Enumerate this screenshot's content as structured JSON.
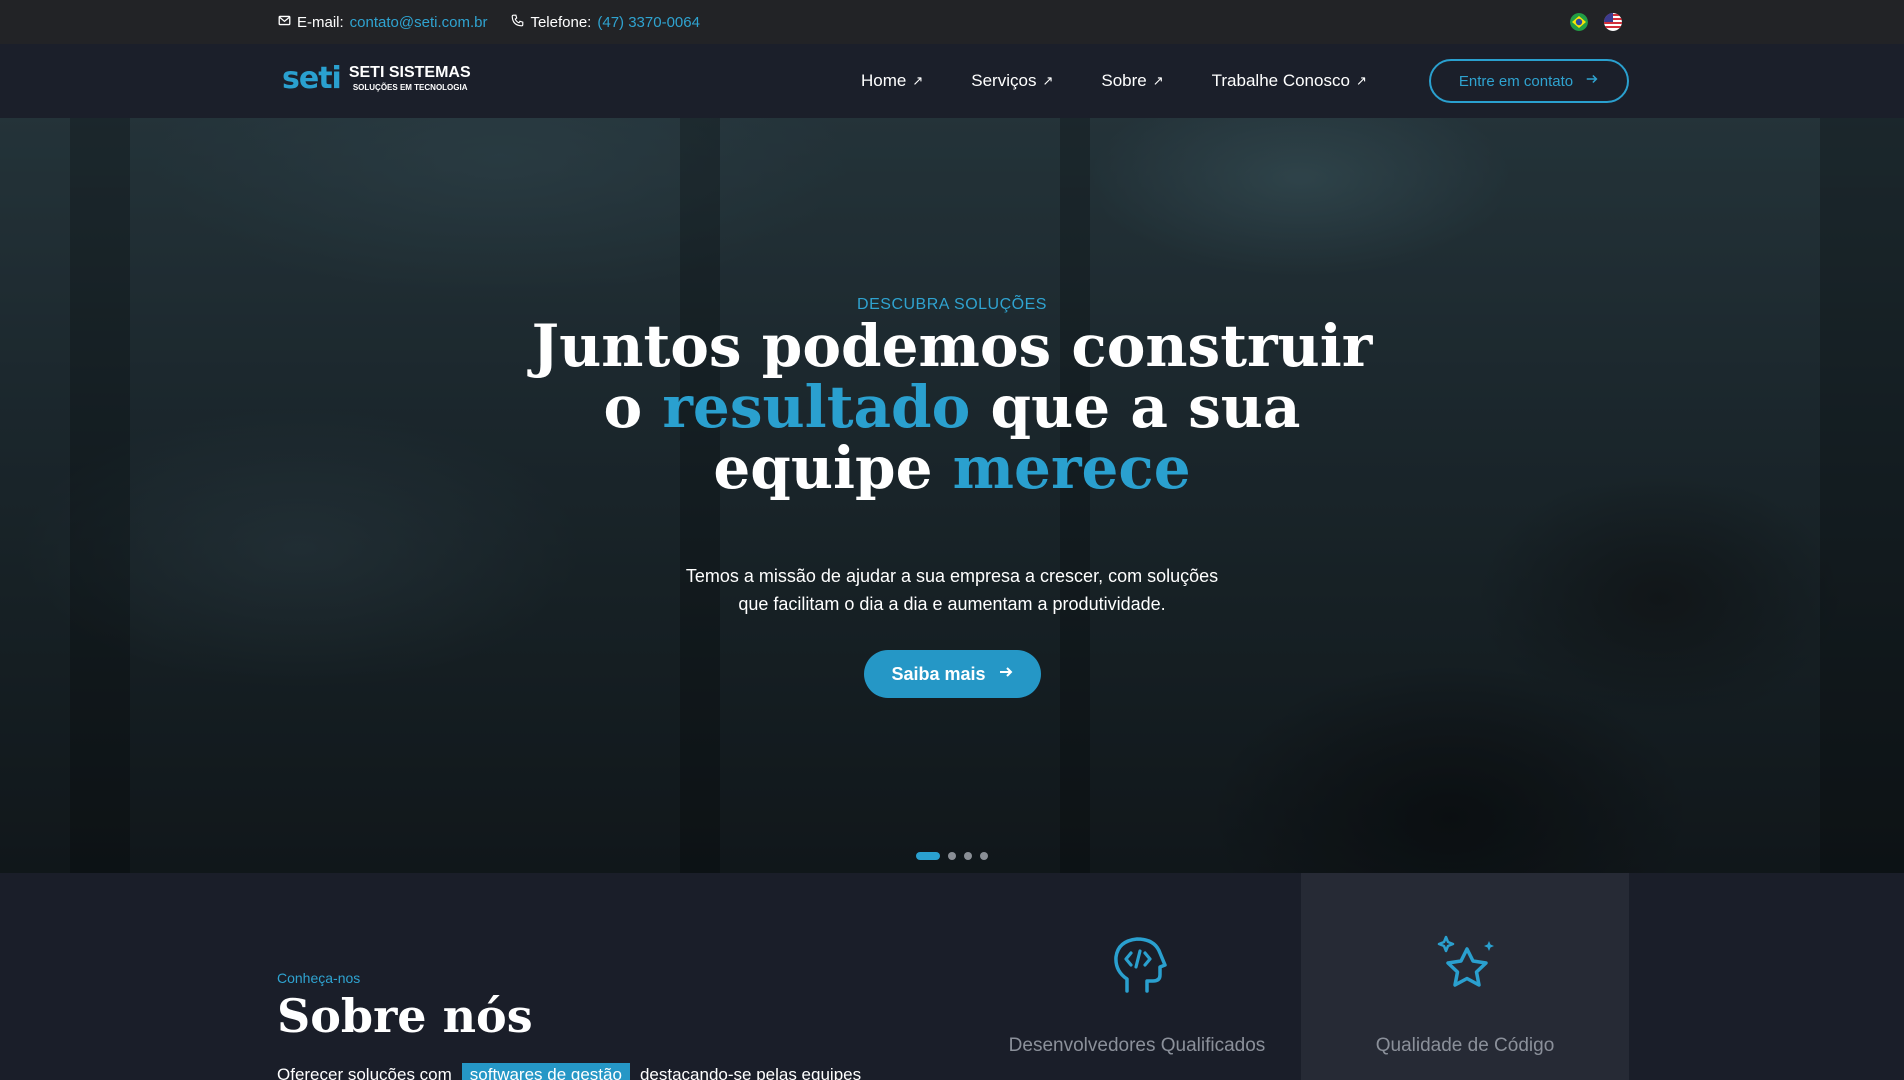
{
  "topbar": {
    "email_label": "E-mail:",
    "email_value": "contato@seti.com.br",
    "phone_label": "Telefone:",
    "phone_value": "(47) 3370-0064",
    "flags": [
      "flag-brazil-icon",
      "flag-usa-icon"
    ]
  },
  "brand": {
    "mark": "seti",
    "name": "SETI SISTEMAS",
    "tagline": "SOLUÇÕES EM TECNOLOGIA"
  },
  "nav": {
    "items": [
      {
        "label": "Home"
      },
      {
        "label": "Serviços"
      },
      {
        "label": "Sobre"
      },
      {
        "label": "Trabalhe Conosco"
      }
    ],
    "cta": "Entre em contato"
  },
  "hero": {
    "kicker": "DESCUBRA SOLUÇÕES",
    "line1": "Juntos podemos construir",
    "line2_a": "o ",
    "line2_hl": "resultado",
    "line2_b": " que a sua",
    "line3_a": "equipe ",
    "line3_hl": "merece",
    "sub1": "Temos a missão de ajudar a sua empresa a crescer, com soluções",
    "sub2": "que facilitam o dia a dia e aumentam a produtividade.",
    "button": "Saiba mais",
    "slides_total": 4,
    "slide_active": 1
  },
  "about": {
    "kicker": "Conheça-nos",
    "title": "Sobre nós",
    "body_a": "Oferecer soluções com",
    "body_tag": "softwares de gestão",
    "body_b": "destacando-se pelas equipes",
    "cards": [
      {
        "label": "Desenvolvedores Qualificados",
        "icon": "head-code-icon"
      },
      {
        "label": "Qualidade de Código",
        "icon": "star-sparkle-icon"
      }
    ]
  },
  "colors": {
    "accent": "#2aa0cf",
    "topbar_bg": "#222326",
    "nav_bg": "#1b1f2a",
    "section_bg": "#1a1e29",
    "card_highlight_bg": "#262a35"
  }
}
